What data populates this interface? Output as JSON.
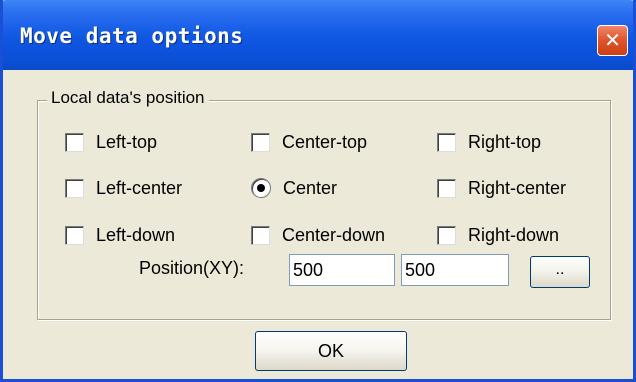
{
  "window": {
    "title": "Move data options",
    "close_label": "✕"
  },
  "group": {
    "label": "Local data's position"
  },
  "options": {
    "left_top": "Left-top",
    "center_top": "Center-top",
    "right_top": "Right-top",
    "left_center": "Left-center",
    "center": "Center",
    "right_center": "Right-center",
    "left_down": "Left-down",
    "center_down": "Center-down",
    "right_down": "Right-down",
    "selected": "Center"
  },
  "position": {
    "label": "Position(XY):",
    "x_value": "500",
    "y_value": "500",
    "browse_label": ".."
  },
  "footer": {
    "ok_label": "OK"
  },
  "colors": {
    "titlebar": "#0a4fd6",
    "dialog_bg": "#ece9d8",
    "close_button": "#e0582f"
  },
  "icons": {
    "close": "close-icon"
  }
}
